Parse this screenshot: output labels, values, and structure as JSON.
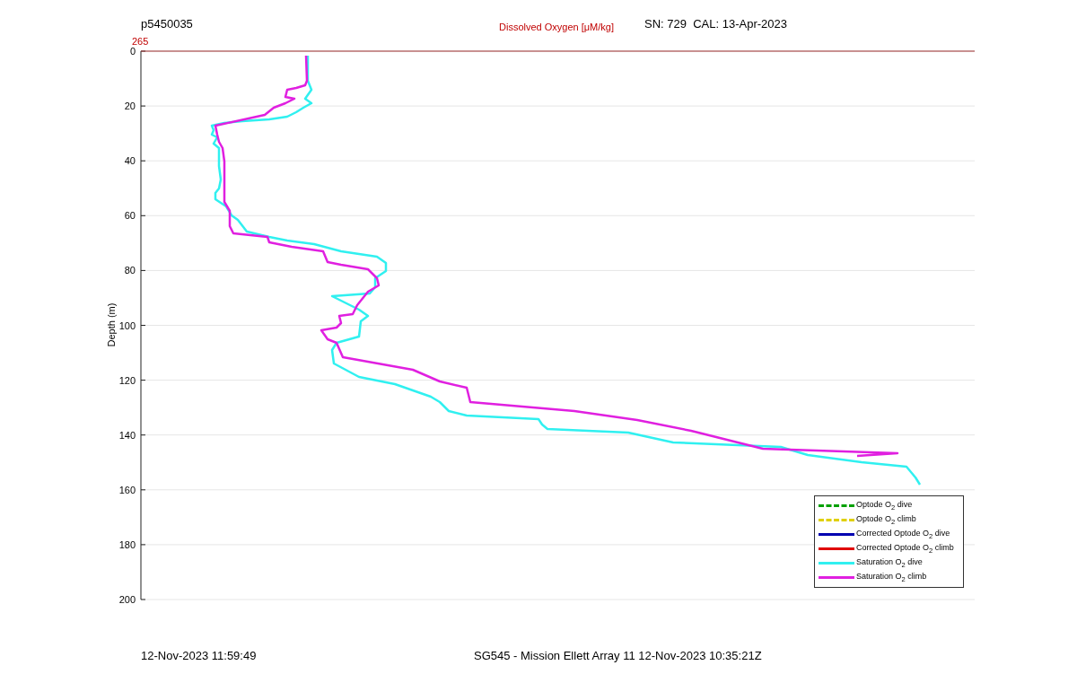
{
  "header": {
    "profile_id": "p5450035",
    "title": "Dissolved Oxygen [μM/kg]",
    "sensor_info": "SN: 729  CAL: 13-Apr-2023"
  },
  "plot": {
    "x_tick": "265",
    "y_label": "Depth (m)",
    "y_ticks": [
      "0",
      "20",
      "40",
      "60",
      "80",
      "100",
      "120",
      "140",
      "160",
      "180",
      "200"
    ],
    "legend": [
      {
        "label": "Optode O$_{2}$ dive",
        "color": "#00a000",
        "kind": "dashed"
      },
      {
        "label": "Optode O$_{2}$ climb",
        "color": "#e0d000",
        "kind": "dashed"
      },
      {
        "label": "Corrected Optode O$_{2}$ dive",
        "color": "#0000b0",
        "kind": "solid"
      },
      {
        "label": "Corrected Optode O$_{2}$ climb",
        "color": "#e00000",
        "kind": "solid"
      },
      {
        "label": "Saturation O$_{2}$ dive",
        "color": "#30f0f0",
        "kind": "solid"
      },
      {
        "label": "Saturation O$_{2}$ climb",
        "color": "#e020e0",
        "kind": "solid"
      }
    ]
  },
  "footer": {
    "timestamp": "12-Nov-2023 11:59:49",
    "mission": "SG545 - Mission Ellett Array 11 12-Nov-2023 10:35:21Z"
  }
}
